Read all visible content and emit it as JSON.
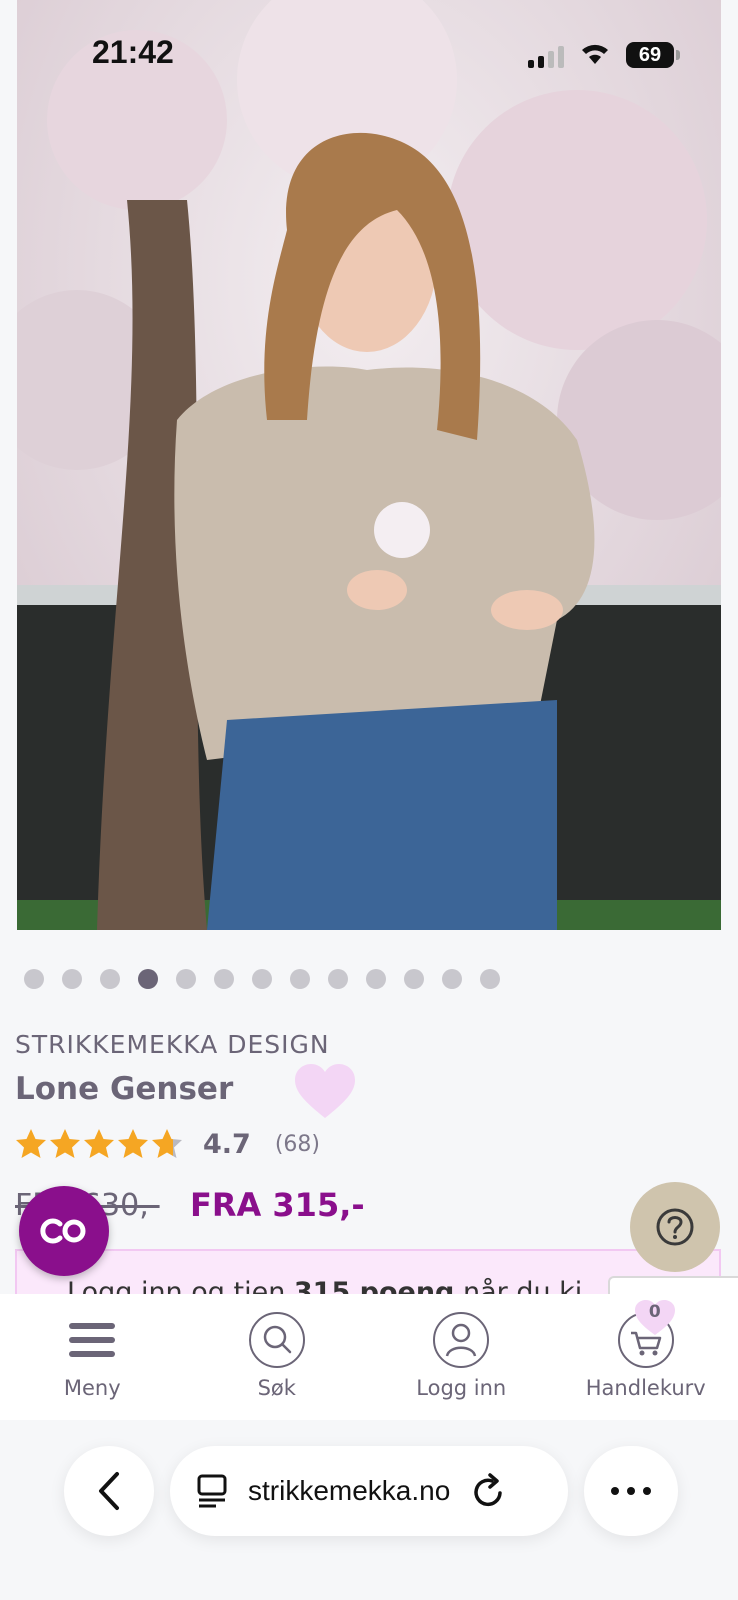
{
  "status_bar": {
    "time": "21:42",
    "battery": "69"
  },
  "carousel": {
    "total": 13,
    "active_index": 3
  },
  "product": {
    "brand": "STRIKKEMEKKA DESIGN",
    "title": "Lone Genser",
    "rating": "4.7",
    "review_count": "(68)",
    "stars": 4.7,
    "price_old": "FRA 630,-",
    "price_new": "FRA 315,-"
  },
  "promo": {
    "text_prefix": "Logg inn og tjen ",
    "points": "315 poeng",
    "text_suffix": " når du ki"
  },
  "bottom_nav": {
    "menu": "Meny",
    "search": "Søk",
    "login": "Logg inn",
    "cart": "Handlekurv",
    "cart_count": "0"
  },
  "browser": {
    "url": "strikkemekka.no"
  },
  "colors": {
    "accent": "#8a0f8c",
    "text": "#6b6577",
    "heart": "#f3d6f5",
    "star": "#f5a623"
  }
}
